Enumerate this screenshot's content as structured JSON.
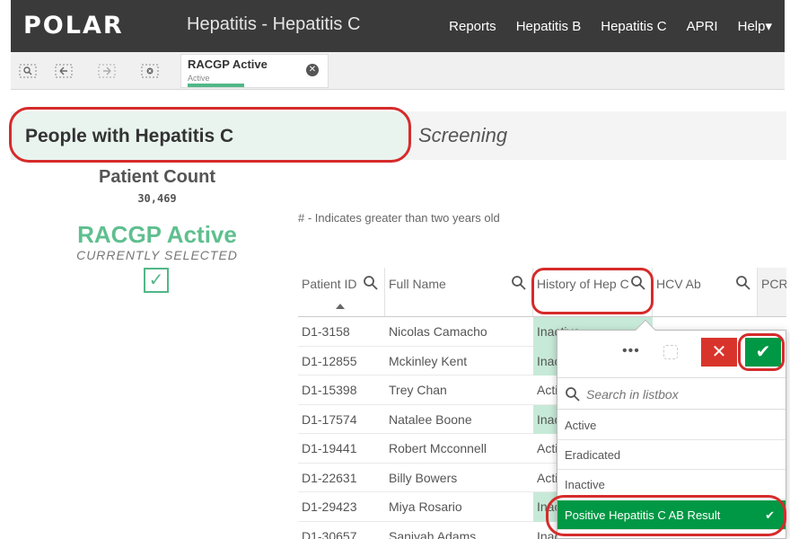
{
  "header": {
    "logo": "POLAR",
    "title": "Hepatitis - Hepatitis C",
    "nav": [
      "Reports",
      "Hepatitis B",
      "Hepatitis C",
      "APRI",
      "Help▾"
    ]
  },
  "toolbar": {
    "tools": [
      "smart-search",
      "selections-tool",
      "step-back",
      "clear-selections"
    ],
    "selection_field": "RACGP Active",
    "selection_value": "Active"
  },
  "sheet": {
    "section_title": "People with Hepatitis C",
    "section_title_2": "Screening"
  },
  "kpi": {
    "label": "Patient Count",
    "value": "30,469",
    "selection_title": "RACGP Active",
    "selection_state": "CURRENTLY SELECTED"
  },
  "note": "# - Indicates greater than two years old",
  "table": {
    "headers": [
      "Patient ID",
      "Full Name",
      "History of Hep C",
      "HCV Ab",
      "PCR"
    ],
    "rows": [
      {
        "id": "D1-3158",
        "name": "Nicolas Camacho",
        "hx": "Inactive",
        "green": true
      },
      {
        "id": "D1-12855",
        "name": "Mckinley Kent",
        "hx": "Inactive",
        "green": true
      },
      {
        "id": "D1-15398",
        "name": "Trey Chan",
        "hx": "Active",
        "green": false
      },
      {
        "id": "D1-17574",
        "name": "Natalee Boone",
        "hx": "Inactive",
        "green": true
      },
      {
        "id": "D1-19441",
        "name": "Robert Mcconnell",
        "hx": "Active",
        "green": false
      },
      {
        "id": "D1-22631",
        "name": "Billy Bowers",
        "hx": "Active",
        "green": false
      },
      {
        "id": "D1-29423",
        "name": "Miya Rosario",
        "hx": "Inactive",
        "green": true
      },
      {
        "id": "D1-30657",
        "name": "Saniyah Adams",
        "hx": "Inactive",
        "green": false
      }
    ]
  },
  "listbox": {
    "more_label": "•••",
    "cancel_label": "✕",
    "confirm_label": "✔",
    "search_placeholder": "Search in listbox",
    "items": [
      "Active",
      "Eradicated",
      "Inactive",
      "Positive Hepatitis C AB Result"
    ],
    "selected_item": "Positive Hepatitis C AB Result"
  },
  "colors": {
    "accent_green": "#52b788",
    "confirm_green": "#009845",
    "cancel_red": "#d9342b",
    "annotation_red": "#d62b2b"
  }
}
